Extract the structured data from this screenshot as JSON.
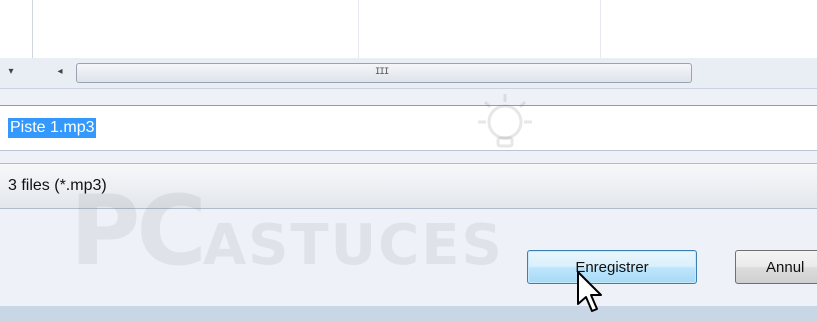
{
  "file_name": {
    "value": "Piste 1.mp3"
  },
  "file_type": {
    "value": "3 files (*.mp3)"
  },
  "scrollbar": {
    "left_arrow": "◂",
    "grip": "III",
    "dropdown_arrow": "▾"
  },
  "buttons": {
    "save_label": "Enregistrer",
    "cancel_label": "Annul"
  },
  "watermark": {
    "big": "PC",
    "rest": "ASTUCES"
  },
  "colors": {
    "selection": "#3399ff",
    "save_button_border": "#3c7fb1"
  }
}
